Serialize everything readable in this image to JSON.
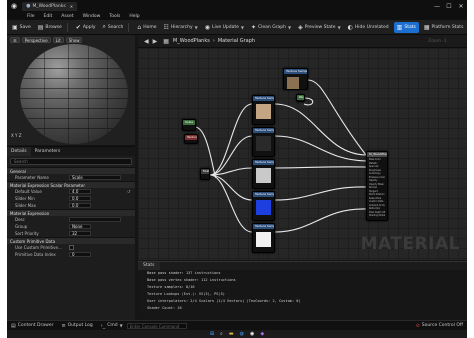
{
  "window": {
    "asset_tab": "M_WoodPlanks",
    "close_glyph": "✕",
    "minimize_glyph": "—",
    "maximize_glyph": "☐"
  },
  "menu": [
    "File",
    "Edit",
    "Asset",
    "Window",
    "Tools",
    "Help"
  ],
  "toolbar": {
    "save": "Save",
    "browse": "Browse",
    "apply": "Apply",
    "search": "Search",
    "home": "Home",
    "hierarchy": "Hierarchy",
    "live_update": "Live Update",
    "clean_graph": "Clean Graph",
    "preview_state": "Preview State",
    "hide_unrelated": "Hide Unrelated",
    "stats": "Stats",
    "platform_stats": "Platform Stats"
  },
  "viewport": {
    "perspective": "Perspective",
    "lit": "Lit",
    "show": "Show",
    "axis_label": "X Y Z"
  },
  "details": {
    "tab_details": "Details",
    "tab_parameters": "Parameters",
    "search_placeholder": "Search",
    "sections": {
      "general": "General",
      "scalar_param": "Material Expression Scalar Parameter",
      "expression": "Material Expression",
      "primitive": "Custom Primitive Data"
    },
    "props": {
      "parameter_name_label": "Parameter Name",
      "parameter_name_value": "Scale",
      "default_value_label": "Default Value",
      "default_value": "4.0",
      "slider_min_label": "Slider Min",
      "slider_min": "0.0",
      "slider_max_label": "Slider Max",
      "slider_max": "0.0",
      "desc_label": "Desc",
      "group_label": "Group",
      "group_value": "None",
      "sort_priority_label": "Sort Priority",
      "sort_priority": "32",
      "use_custom_label": "Use Custom Primitive...",
      "primitive_index_label": "Primitive Data Index",
      "primitive_index": "0"
    }
  },
  "graph": {
    "breadcrumb_asset": "M_WoodPlanks",
    "breadcrumb_graph": "Material Graph",
    "zoom": "Zoom -1",
    "watermark": "MATERIAL",
    "nodes": [
      {
        "title": "Texture Sample",
        "preview_color": "#8a7152"
      },
      {
        "title": "Param",
        "preview_color": ""
      },
      {
        "title": "Texture Sample",
        "preview_color": "#c4a583"
      },
      {
        "title": "Texture Sample",
        "preview_color": "#2a2a2a"
      },
      {
        "title": "Texture Sample",
        "preview_color": "#c9c9c9"
      },
      {
        "title": "Texture Sample",
        "preview_color": "#1d3fe0"
      },
      {
        "title": "Texture Sample",
        "preview_color": "#f2f2f2"
      },
      {
        "title": "Scale",
        "preview_color": ""
      },
      {
        "title": "Multiply",
        "preview_color": ""
      },
      {
        "title": "TexCoord",
        "preview_color": ""
      },
      {
        "title": "M_WoodPlanks",
        "preview_color": ""
      }
    ],
    "output_pins": [
      "Base Color",
      "Metallic",
      "Specular",
      "Roughness",
      "Anisotropy",
      "Emissive Color",
      "Opacity",
      "Opacity Mask",
      "Normal",
      "Tangent",
      "World Position Offset",
      "Subsurface",
      "Custom Data",
      "Ambient Occlusion",
      "Refraction",
      "Pixel Depth Offset",
      "Shading Model"
    ]
  },
  "stats": {
    "tab": "Stats",
    "lines": [
      "Base pass shader: 137 instructions",
      "Base pass vertex shader: 112 instructions",
      "Texture samplers: 8/16",
      "Texture Lookups (Est.): VS(3), PS(5)",
      "User interpolators: 2/4 Scalars (1/4 Vectors) (TexCoords: 2, Custom: 0)",
      "Shader Count: 16"
    ]
  },
  "bottom": {
    "content_drawer": "Content Drawer",
    "output_log": "Output Log",
    "cmd": "Cmd",
    "console_placeholder": "Enter Console Command",
    "source_control": "Source Control Off"
  },
  "colors": {
    "accent": "#1c6fd1",
    "node_header_blue": "#2c4e7a",
    "wire": "#e8e8e8"
  }
}
